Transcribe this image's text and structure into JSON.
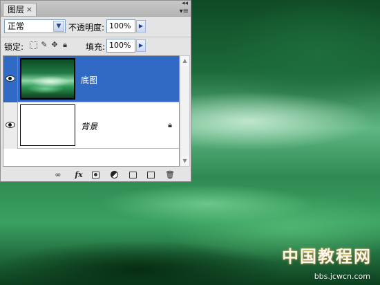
{
  "panel": {
    "tab_label": "图层",
    "tab_close": "×",
    "menu_glyph": "▾≡",
    "collapse_glyph": "◂◂"
  },
  "blend": {
    "mode": "正常",
    "opacity_label": "不透明度:",
    "opacity_value": "100%"
  },
  "lock": {
    "label": "锁定:",
    "fill_label": "填充:",
    "fill_value": "100%"
  },
  "layers": [
    {
      "name": "底图",
      "selected": true,
      "visible": true,
      "locked": false,
      "thumbnail": "green-blurred-image"
    },
    {
      "name": "背景",
      "selected": false,
      "visible": true,
      "locked": true,
      "thumbnail": "white"
    }
  ],
  "bottom_icons": [
    "link-icon",
    "fx-icon",
    "add-mask-icon",
    "adjustment-layer-icon",
    "new-group-icon",
    "new-layer-icon",
    "trash-icon"
  ],
  "fx_label": "fx",
  "watermark": {
    "text": "中国教程网",
    "url": "bbs.jcwcn.com"
  },
  "colors": {
    "selection": "#316ac5",
    "panel_bg": "#e4e4e4"
  }
}
